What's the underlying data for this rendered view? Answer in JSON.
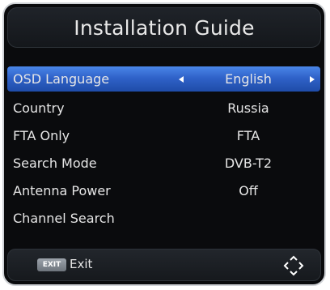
{
  "title": "Installation Guide",
  "menu": {
    "items": [
      {
        "label": "OSD Language",
        "value": "English"
      },
      {
        "label": "Country",
        "value": "Russia"
      },
      {
        "label": "FTA Only",
        "value": "FTA"
      },
      {
        "label": "Search Mode",
        "value": "DVB-T2"
      },
      {
        "label": "Antenna Power",
        "value": "Off"
      },
      {
        "label": "Channel Search",
        "value": ""
      }
    ]
  },
  "footer": {
    "exit_key": "EXIT",
    "exit_label": "Exit",
    "nav_icon": "navigation-arrows-icon"
  },
  "colors": {
    "background": "#0a0b0d",
    "selected_row": "#2f62c9",
    "text": "#e6e6e6"
  }
}
